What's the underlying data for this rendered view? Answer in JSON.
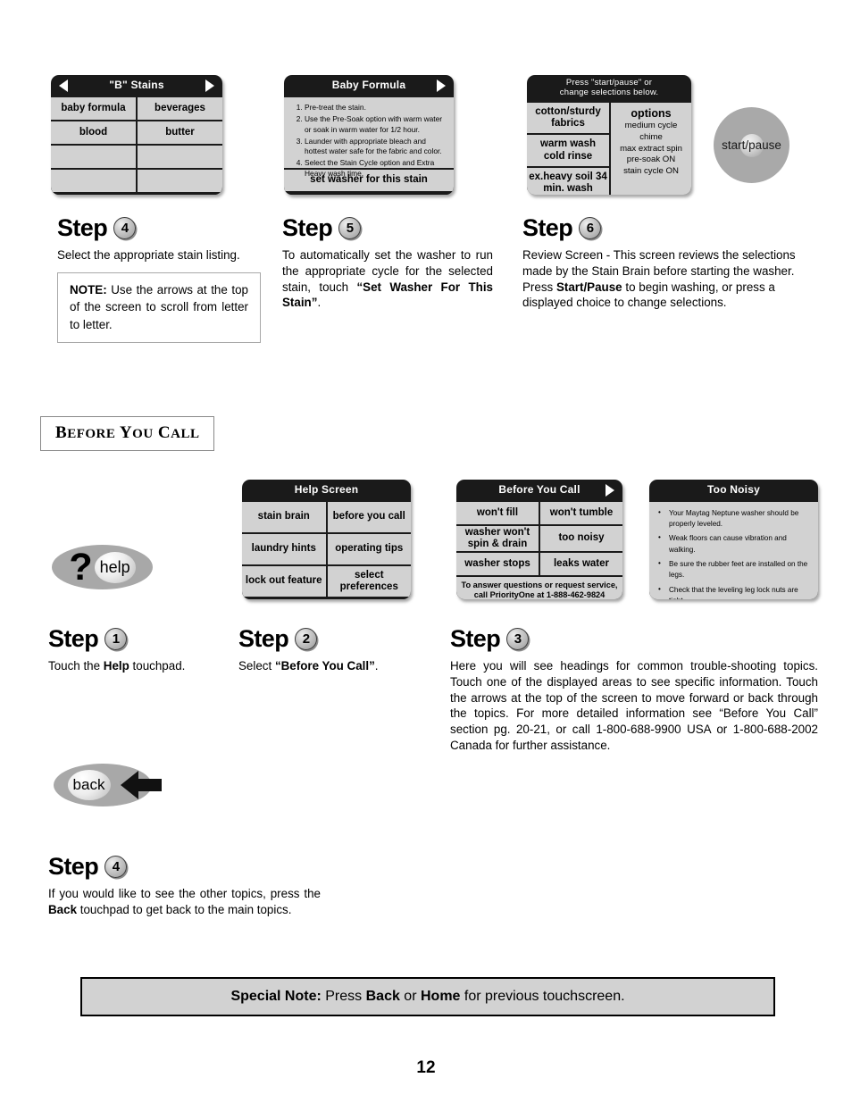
{
  "page": {
    "number": "12"
  },
  "screens": {
    "b_stains": {
      "title": "\"B\" Stains",
      "arrow_left": "left-arrow",
      "arrow_right": "right-arrow",
      "cells": [
        "baby formula",
        "beverages",
        "blood",
        "butter",
        "",
        "",
        "",
        ""
      ]
    },
    "baby_formula": {
      "title": "Baby Formula",
      "arrow_right": "right-arrow",
      "steps": [
        "Pre-treat the stain.",
        "Use the Pre-Soak option with warm water or soak in warm water for 1/2 hour.",
        "Launder with appropriate bleach and hottest water safe for the fabric and color.",
        "Select the Stain Cycle option and Extra Heavy wash time."
      ],
      "action": "set washer for this stain"
    },
    "review": {
      "title_line1": "Press \"start/pause\" or",
      "title_line2": "change selections below.",
      "left_cells": [
        "cotton/sturdy fabrics",
        "warm wash cold rinse",
        "ex.heavy soil 34 min. wash"
      ],
      "options_title": "options",
      "options": [
        "medium cycle chime",
        "max extract spin",
        "pre-soak ON",
        "stain cycle ON"
      ]
    },
    "help": {
      "title": "Help Screen",
      "cells": [
        "stain brain",
        "before you call",
        "laundry hints",
        "operating tips",
        "lock out feature",
        "select preferences"
      ]
    },
    "before_you_call": {
      "title": "Before You Call",
      "arrow_right": "right-arrow",
      "cells": [
        "won't fill",
        "won't tumble",
        "washer won't spin & drain",
        "too noisy",
        "washer stops",
        "leaks water"
      ],
      "footer_line1": "To answer questions or request service,",
      "footer_line2": "call PriorityOne at 1-888-462-9824"
    },
    "too_noisy": {
      "title": "Too Noisy",
      "bullets": [
        "Your Maytag Neptune washer should be properly leveled.",
        "Weak floors can cause vibration and walking.",
        "Be sure the rubber feet are installed on the legs.",
        "Check that the leveling leg lock nuts are tight."
      ]
    }
  },
  "steps_top": {
    "step4": {
      "label": "Step",
      "number": "4",
      "text": "Select the appropriate stain listing.",
      "note_label": "NOTE:",
      "note_text": " Use the arrows at the top of the screen to scroll from letter to letter."
    },
    "step5": {
      "label": "Step",
      "number": "5",
      "text_before": "To automatically set the washer to run the appropriate cycle for the selected stain, touch ",
      "text_bold": "“Set Washer For This Stain”",
      "text_after": "."
    },
    "step6": {
      "label": "Step",
      "number": "6",
      "text_before": "Review Screen - This screen reviews the selections made by the Stain Brain before starting the washer. Press ",
      "text_bold": "Start/Pause",
      "text_after": " to begin washing, or press a displayed choice to change selections."
    }
  },
  "section": {
    "title_full": "Before You Call",
    "b": "B",
    "efore": "EFORE",
    "y": "Y",
    "ou": "OU",
    "c": "C",
    "all": "ALL"
  },
  "steps_bottom": {
    "step1": {
      "label": "Step",
      "number": "1",
      "text_before": "Touch the ",
      "text_bold": "Help",
      "text_after": " touchpad."
    },
    "step2": {
      "label": "Step",
      "number": "2",
      "text_before": "Select ",
      "text_bold": "“Before You Call”",
      "text_after": "."
    },
    "step3": {
      "label": "Step",
      "number": "3",
      "text": "Here you will see headings for common trouble-shooting topics. Touch one of the displayed areas to see specific information. Touch the arrows at the top of the screen to move forward or back through the topics.  For more detailed information see “Before You Call” section pg. 20-21, or call 1-800-688-9900 USA or 1-800-688-2002 Canada for further assistance."
    },
    "step4": {
      "label": "Step",
      "number": "4",
      "text_before": "If you would like to see the other topics, press the ",
      "text_bold": "Back",
      "text_after": " touchpad to get back to the main topics."
    }
  },
  "touchpads": {
    "help": {
      "symbol": "?",
      "label": "help"
    },
    "back": {
      "label": "back",
      "arrow": "left-arrow"
    },
    "start_pause": {
      "label": "start/pause"
    }
  },
  "special_note": {
    "label": "Special Note:",
    "text_before": " Press ",
    "bold1": "Back",
    "mid": " or ",
    "bold2": "Home",
    "text_after": " for previous touchscreen."
  }
}
